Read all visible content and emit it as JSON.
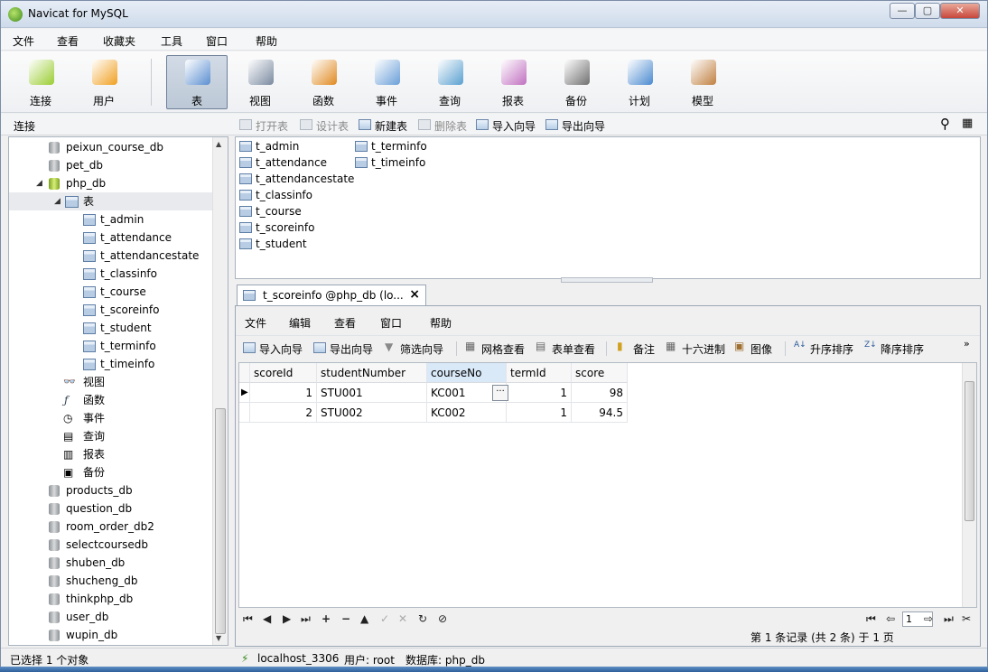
{
  "window": {
    "title": "Navicat for MySQL"
  },
  "menu": [
    "文件",
    "查看",
    "收藏夹",
    "工具",
    "窗口",
    "帮助"
  ],
  "toolbar": [
    {
      "label": "连接",
      "icon": "connection-icon",
      "color": "#9acd32"
    },
    {
      "label": "用户",
      "icon": "user-icon",
      "color": "#f0a020"
    },
    {
      "label": "表",
      "icon": "table-icon",
      "color": "#5b8fd0",
      "active": true
    },
    {
      "label": "视图",
      "icon": "view-icon",
      "color": "#7a8aa0"
    },
    {
      "label": "函数",
      "icon": "function-icon",
      "color": "#e08a20"
    },
    {
      "label": "事件",
      "icon": "event-icon",
      "color": "#6a9fd8"
    },
    {
      "label": "查询",
      "icon": "query-icon",
      "color": "#5aa0d0"
    },
    {
      "label": "报表",
      "icon": "report-icon",
      "color": "#c070c0"
    },
    {
      "label": "备份",
      "icon": "backup-icon",
      "color": "#707070"
    },
    {
      "label": "计划",
      "icon": "schedule-icon",
      "color": "#4a8ad0"
    },
    {
      "label": "模型",
      "icon": "model-icon",
      "color": "#c08040"
    }
  ],
  "subbar": {
    "label": "连接",
    "items": [
      {
        "label": "打开表",
        "disabled": true
      },
      {
        "label": "设计表",
        "disabled": true
      },
      {
        "label": "新建表",
        "disabled": false
      },
      {
        "label": "删除表",
        "disabled": true
      },
      {
        "label": "导入向导",
        "disabled": false
      },
      {
        "label": "导出向导",
        "disabled": false
      }
    ]
  },
  "tree": {
    "db_before": [
      "peixun_course_db",
      "pet_db"
    ],
    "open_db": "php_db",
    "tables_node": "表",
    "tables": [
      "t_admin",
      "t_attendance",
      "t_attendancestate",
      "t_classinfo",
      "t_course",
      "t_scoreinfo",
      "t_student",
      "t_terminfo",
      "t_timeinfo"
    ],
    "other_nodes": [
      {
        "label": "视图",
        "icon": "view-icon"
      },
      {
        "label": "函数",
        "icon": "function-icon"
      },
      {
        "label": "事件",
        "icon": "event-icon"
      },
      {
        "label": "查询",
        "icon": "query-icon"
      },
      {
        "label": "报表",
        "icon": "report-icon"
      },
      {
        "label": "备份",
        "icon": "backup-icon"
      }
    ],
    "db_after": [
      "products_db",
      "question_db",
      "room_order_db2",
      "selectcoursedb",
      "shuben_db",
      "shucheng_db",
      "thinkphp_db",
      "user_db",
      "wupin_db"
    ]
  },
  "objects": {
    "col1": [
      "t_admin",
      "t_attendance",
      "t_attendancestate",
      "t_classinfo",
      "t_course",
      "t_scoreinfo",
      "t_student"
    ],
    "col2": [
      "t_terminfo",
      "t_timeinfo"
    ]
  },
  "tab": {
    "title": "t_scoreinfo @php_db (lo...",
    "close": "×"
  },
  "inner_menu": [
    "文件",
    "编辑",
    "查看",
    "窗口",
    "帮助"
  ],
  "inner_tools": [
    "导入向导",
    "导出向导",
    "筛选向导",
    "网格查看",
    "表单查看",
    "备注",
    "十六进制",
    "图像",
    "升序排序",
    "降序排序"
  ],
  "grid": {
    "columns": [
      "scoreId",
      "studentNumber",
      "courseNo",
      "termId",
      "score"
    ],
    "rows": [
      [
        "1",
        "STU001",
        "KC001",
        "1",
        "98"
      ],
      [
        "2",
        "STU002",
        "KC002",
        "1",
        "94.5"
      ]
    ],
    "ellipsis": "···"
  },
  "pager": {
    "page": "1",
    "record_info": "第 1 条记录 (共 2 条) 于 1 页"
  },
  "status": {
    "selection": "已选择 1 个对象",
    "connection": "localhost_3306",
    "user": "用户: root",
    "database": "数据库: php_db"
  }
}
